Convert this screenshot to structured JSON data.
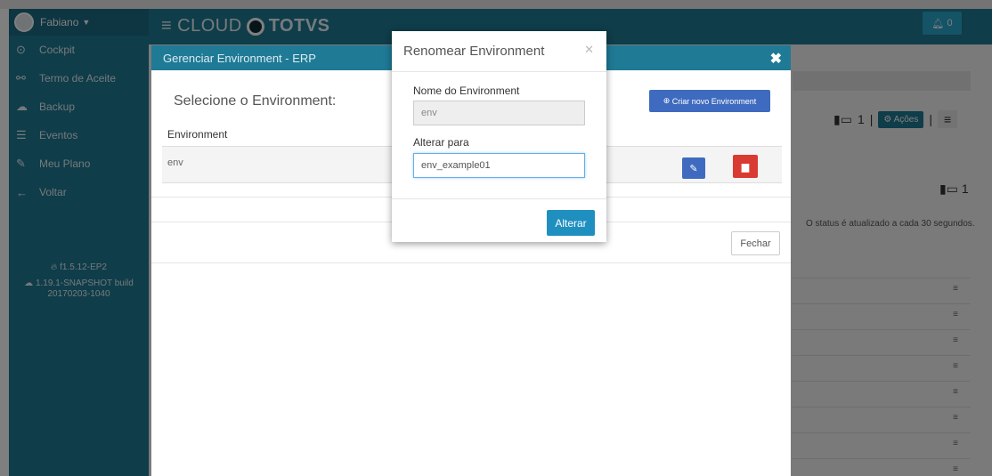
{
  "sidebar": {
    "user": "Fabiano",
    "items": [
      {
        "icon": "gauge-icon",
        "glyph": "⊙",
        "label": "Cockpit"
      },
      {
        "icon": "handshake-icon",
        "glyph": "⚯",
        "label": "Termo de Aceite"
      },
      {
        "icon": "cloud-upload-icon",
        "glyph": "☁",
        "label": "Backup"
      },
      {
        "icon": "list-icon",
        "glyph": "☰",
        "label": "Eventos"
      },
      {
        "icon": "edit-icon",
        "glyph": "✎",
        "label": "Meu Plano"
      },
      {
        "icon": "arrow-left-icon",
        "glyph": "←",
        "label": "Voltar"
      }
    ],
    "version_line1": "f1.5.12-EP2",
    "version_line2": "1.19.1-SNAPSHOT build",
    "version_line3": "20170203-1040"
  },
  "header": {
    "cloud": "CLOUD",
    "totvs": "TOTVS",
    "notif_count": "0"
  },
  "right_panel": {
    "server_count": "1",
    "acoes": "Ações",
    "server_count2": "1",
    "status_text": "O status é atualizado a cada 30 segundos."
  },
  "gerenciar": {
    "title": "Gerenciar Environment - ERP",
    "select_title": "Selecione o Environment:",
    "criar": "Criar novo Environment",
    "column": "Environment",
    "rows": [
      {
        "name": "env"
      }
    ],
    "fechar": "Fechar"
  },
  "renomear": {
    "title": "Renomear Environment",
    "label_nome": "Nome do Environment",
    "value_nome": "env",
    "label_alterar": "Alterar para",
    "value_alterar": "env_example01",
    "button": "Alterar"
  },
  "colors": {
    "teal": "#1f7a95",
    "blue": "#3e6bbf",
    "red": "#d93a32"
  }
}
